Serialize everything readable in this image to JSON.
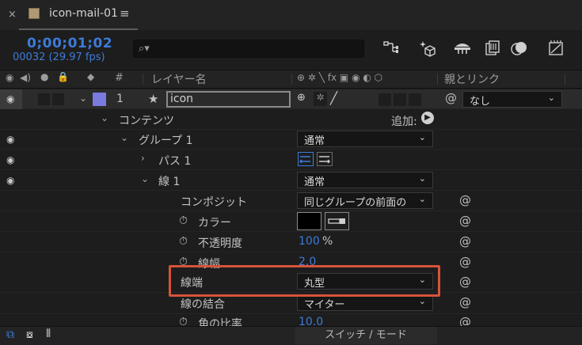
{
  "tab": {
    "close": "×",
    "title": "icon-mail-01",
    "menu": "≡"
  },
  "toolbar": {
    "timecode": "0;00;01;02",
    "frames": "00032 (29.97 fps)",
    "search_placeholder": "",
    "search_icon_glyph": "⌕▾"
  },
  "header": {
    "layer_name": "レイヤー名",
    "hash": "#",
    "parent_link": "親とリンク",
    "switches": "⊕ ✲ ╲ fx ▣ ◉ ◐ ⬡"
  },
  "layer": {
    "index": "1",
    "star": "★",
    "name": "icon",
    "parent": "なし",
    "label_color": "#7a7adf"
  },
  "rows": {
    "contents": "コンテンツ",
    "add_label": "追加:",
    "group1": "グループ 1",
    "group1_mode": "通常",
    "path1": "パス 1",
    "stroke1": "線 1",
    "stroke1_mode": "通常",
    "composite": "コンポジット",
    "composite_value": "同じグループの前面の",
    "color": "カラー",
    "opacity": "不透明度",
    "opacity_value": "100",
    "opacity_unit": "%",
    "width": "線幅",
    "width_value": "2.0",
    "cap": "線端",
    "cap_value": "丸型",
    "join": "線の結合",
    "join_value": "マイター",
    "miter": "角の比率",
    "miter_value": "10.0"
  },
  "bottom": {
    "toggle": "スイッチ / モード"
  },
  "colors": {
    "accent_blue": "#3d7bd9",
    "highlight_red": "#d6533a",
    "stroke_color": "#000000"
  }
}
